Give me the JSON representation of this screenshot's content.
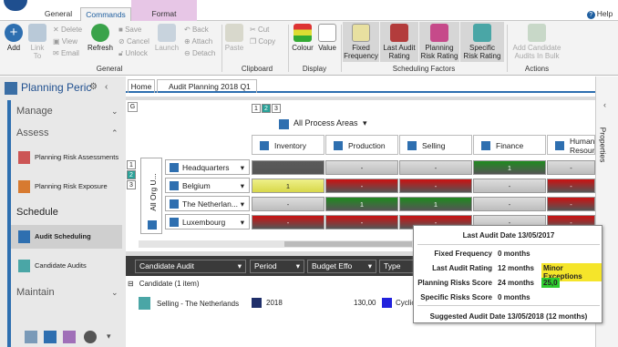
{
  "tabs": {
    "general": "General",
    "commands": "Commands",
    "format": "Format",
    "help": "Help"
  },
  "ribbon": {
    "add": "Add",
    "link_to": "Link\nTo",
    "delete": "Delete",
    "view": "View",
    "email": "Email",
    "refresh": "Refresh",
    "save": "Save",
    "cancel": "Cancel",
    "unlock": "Unlock",
    "launch": "Launch",
    "back": "Back",
    "attach": "Attach",
    "detach": "Detach",
    "paste": "Paste",
    "cut": "Cut",
    "copy": "Copy",
    "colour": "Colour",
    "value": "Value",
    "fixed_frequency": "Fixed\nFrequency",
    "last_audit_rating": "Last Audit\nRating",
    "planning_risk_rating": "Planning\nRisk Rating",
    "specific_risk_rating": "Specific\nRisk Rating",
    "add_candidate": "Add Candidate\nAudits In Bulk",
    "groups": [
      "General",
      "Clipboard",
      "Display",
      "Scheduling Factors",
      "Actions"
    ]
  },
  "nav": {
    "title": "Planning Peric",
    "manage": "Manage",
    "assess": "Assess",
    "assess_items": [
      "Planning Risk Assessments",
      "Planning Risk Exposure"
    ],
    "schedule": "Schedule",
    "schedule_items": [
      "Audit Scheduling",
      "Candidate Audits"
    ],
    "maintain": "Maintain"
  },
  "doc_tabs": [
    "Home",
    "Audit Planning 2018 Q1"
  ],
  "properties": "Properties",
  "grid": {
    "level_buttons": [
      "1",
      "2",
      "3"
    ],
    "process_root": "All Process Areas",
    "columns": [
      "Inventory",
      "Production",
      "Selling",
      "Finance",
      "Human Resour"
    ],
    "org_root": "All Org U...",
    "rows": [
      {
        "name": "Headquarters",
        "cells": [
          "",
          "-",
          "-",
          "1",
          "-"
        ]
      },
      {
        "name": "Belgium",
        "cells": [
          "1",
          "-",
          "-",
          "-",
          "-"
        ]
      },
      {
        "name": "The Netherlan...",
        "cells": [
          "-",
          "1",
          "1",
          "-",
          "-"
        ]
      },
      {
        "name": "Luxembourg",
        "cells": [
          "-",
          "-",
          "-",
          "-",
          "-"
        ]
      }
    ],
    "colors": {
      "dark": "#5a5a5a",
      "grey": "#bdbdbd",
      "green": "#1e8a1e",
      "red": "#cc1111",
      "yellow": "#d8d84a"
    }
  },
  "list": {
    "columns": [
      "Candidate Audit",
      "Period",
      "Budget Effo",
      "Type"
    ],
    "group_label": "Candidate (1 item)",
    "row": {
      "name": "Selling - The Netherlands",
      "period": "2018",
      "budget": "130,00",
      "type": "Cyclic"
    }
  },
  "popup": {
    "title": "Last Audit Date 13/05/2017",
    "rows": [
      {
        "label": "Fixed Frequency",
        "value": "0 months",
        "badge": ""
      },
      {
        "label": "Last Audit Rating",
        "value": "12 months",
        "badge": "Minor Exceptions"
      },
      {
        "label": "Planning Risks Score",
        "value": "24 months",
        "badge": "25,0"
      },
      {
        "label": "Specific Risks Score",
        "value": "0 months",
        "badge": ""
      }
    ],
    "footer": "Suggested Audit Date 13/05/2018 (12 months)"
  }
}
